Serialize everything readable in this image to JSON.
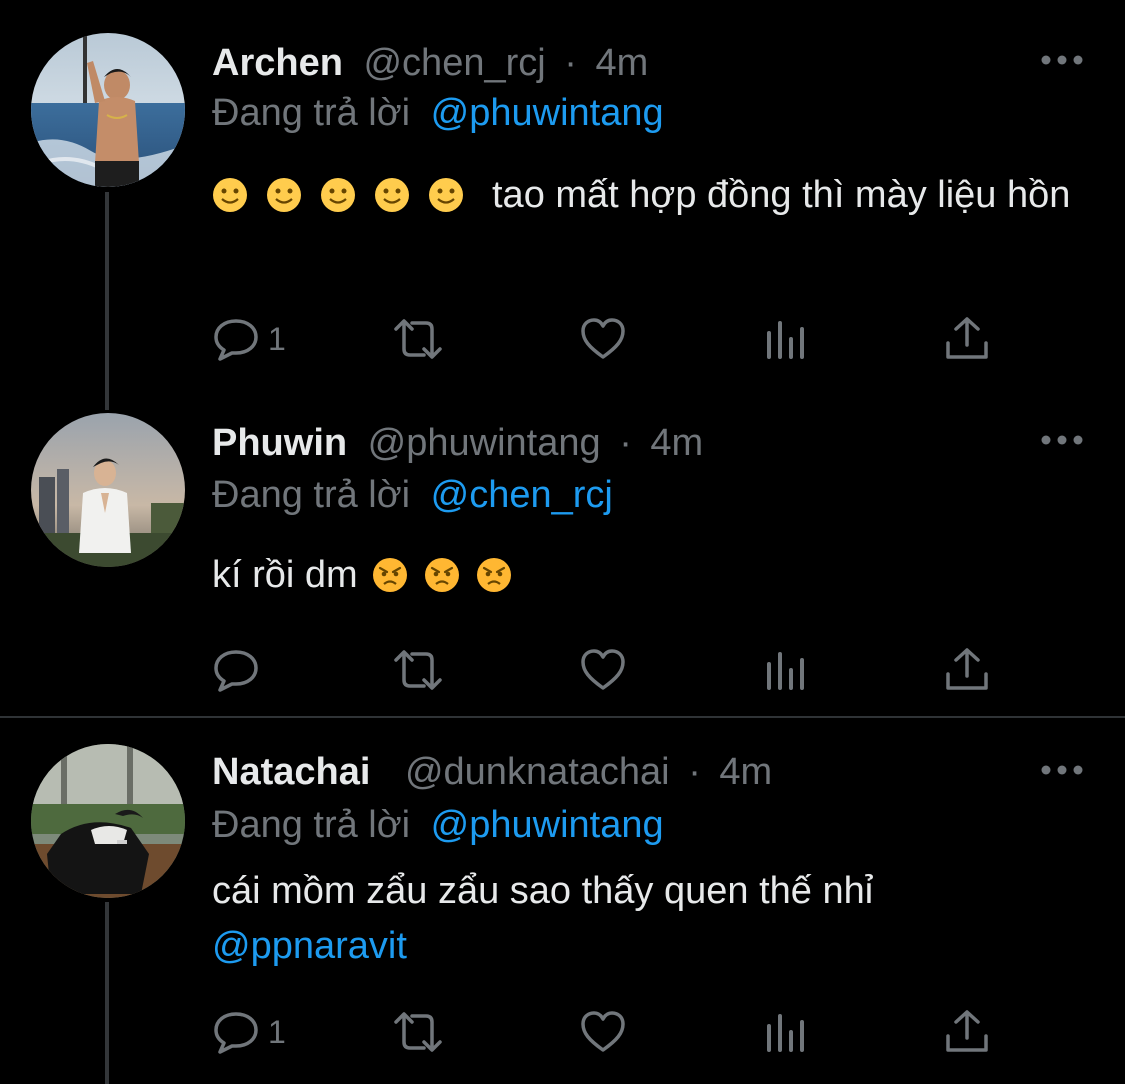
{
  "tweets": [
    {
      "name": "Archen",
      "handle": "@chen_rcj",
      "separator": "·",
      "time": "4m",
      "reply_prefix": "Đang trả lời",
      "reply_to": "@phuwintang",
      "text": "tao mất hợp đồng thì mày liệu hồn",
      "emoji": [
        "slightly-smiling-face",
        "slightly-smiling-face",
        "slightly-smiling-face",
        "slightly-smiling-face",
        "slightly-smiling-face"
      ],
      "reply_count": "1"
    },
    {
      "name": "Phuwin",
      "handle": "@phuwintang",
      "separator": "·",
      "time": "4m",
      "reply_prefix": "Đang trả lời",
      "reply_to": "@chen_rcj",
      "text": "kí rồi dm",
      "emoji": [
        "angry-face",
        "angry-face",
        "angry-face"
      ],
      "reply_count": ""
    },
    {
      "name": "Natachai",
      "handle": "@dunknatachai",
      "separator": "·",
      "time": "4m",
      "reply_prefix": "Đang trả lời",
      "reply_to": "@phuwintang",
      "text": "cái mồm zẩu zẩu sao thấy quen thế nhỉ",
      "mention": "@ppnaravit",
      "reply_count": "1"
    }
  ],
  "icons": [
    "reply-icon",
    "retweet-icon",
    "like-icon",
    "views-icon",
    "share-icon",
    "more-icon"
  ],
  "colors": {
    "background": "#000000",
    "text": "#e7e9ea",
    "muted": "#71767b",
    "link": "#1d9bf0",
    "divider": "#2f3336"
  }
}
